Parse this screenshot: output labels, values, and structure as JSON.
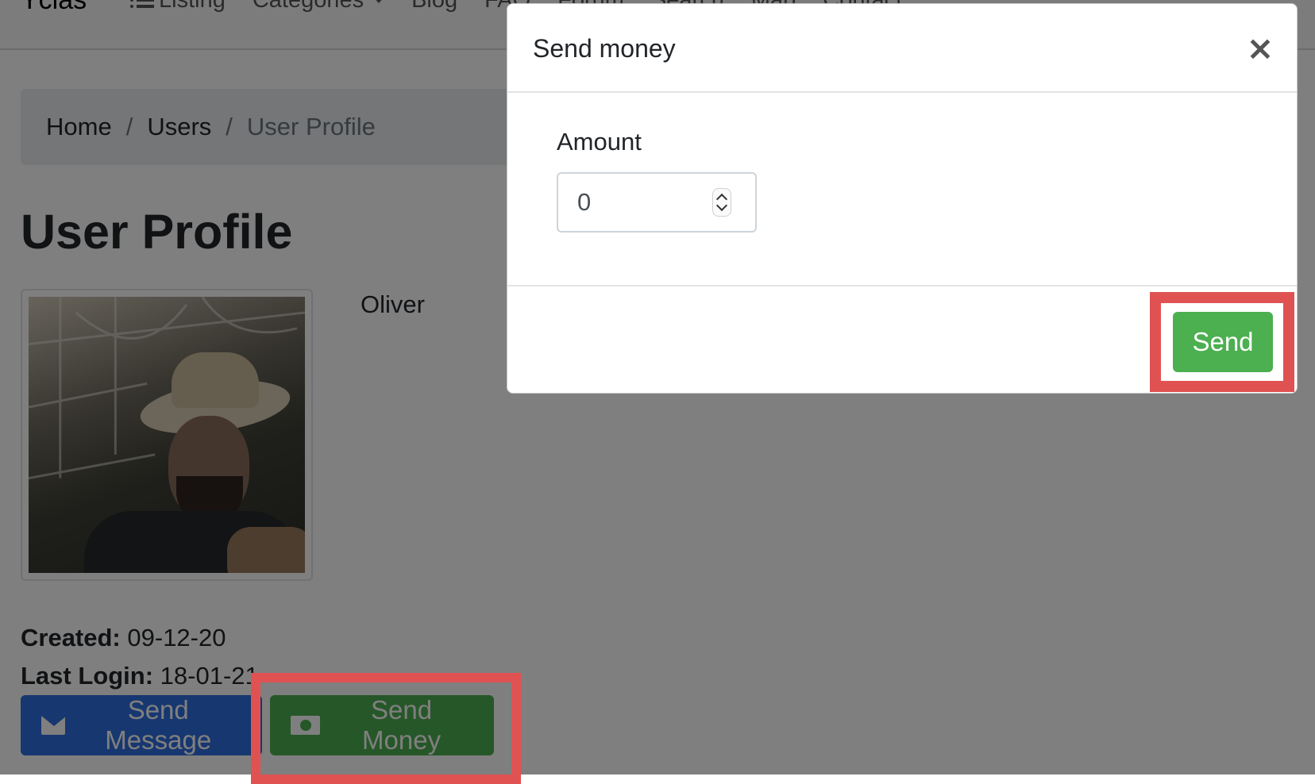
{
  "navbar": {
    "brand": "Yclas",
    "items": [
      {
        "label": "Listing",
        "icon": "list-icon"
      },
      {
        "label": "Categories",
        "icon": "chevron-down-icon"
      },
      {
        "label": "Blog"
      },
      {
        "label": "FAQ"
      },
      {
        "label": "Forum"
      },
      {
        "label": "Search"
      },
      {
        "label": "Map"
      },
      {
        "label": "Contact"
      }
    ]
  },
  "breadcrumb": {
    "items": [
      "Home",
      "Users"
    ],
    "separator": "/",
    "active": "User Profile"
  },
  "profile": {
    "title": "User Profile",
    "name": "Oliver",
    "created_label": "Created:",
    "created_value": "09-12-20",
    "last_login_label": "Last Login:",
    "last_login_value": "18-01-21"
  },
  "actions": {
    "send_message_label": "Send Message",
    "send_money_label": "Send Money"
  },
  "modal": {
    "title": "Send money",
    "close_symbol": "×",
    "amount_label": "Amount",
    "amount_value": "0",
    "send_label": "Send"
  },
  "colors": {
    "primary": "#2f6fe0",
    "success": "#4caf50",
    "highlight": "#e05252"
  }
}
